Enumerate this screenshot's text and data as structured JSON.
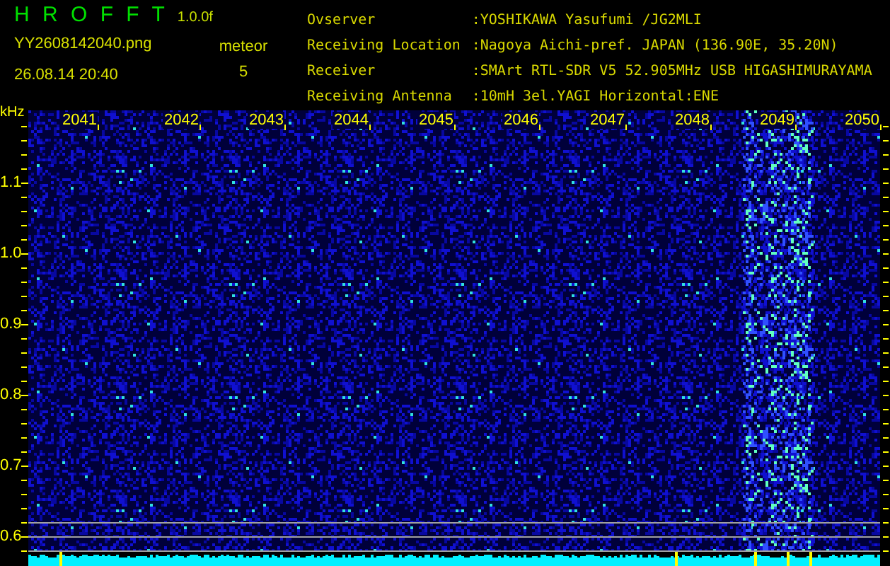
{
  "header": {
    "app_title": "H R O F F T",
    "version": "1.0.0f",
    "filename": "YY2608142040.png",
    "timestamp": "26.08.14 20:40",
    "event_label": "meteor",
    "event_count": "5"
  },
  "station_info": [
    {
      "label": "Ovserver",
      "value": ":YOSHIKAWA Yasufumi /JG2MLI"
    },
    {
      "label": "Receiving Location",
      "value": ":Nagoya Aichi-pref. JAPAN (136.90E, 35.20N)"
    },
    {
      "label": "Receiver",
      "value": ":SMArt RTL-SDR V5 52.905MHz USB HIGASHIMURAYAMA"
    },
    {
      "label": "Receiving Antenna",
      "value": ":10mH 3el.YAGI Horizontal:ENE"
    }
  ],
  "waterfall": {
    "unit": "kHz",
    "y_labels": [
      "1.1",
      "1.0",
      "0.9",
      "0.8",
      "0.7",
      "0.6"
    ],
    "time_labels": [
      "2041",
      "2042",
      "2043",
      "2044",
      "2045",
      "2046",
      "2047",
      "2048",
      "2049",
      "2050"
    ]
  }
}
